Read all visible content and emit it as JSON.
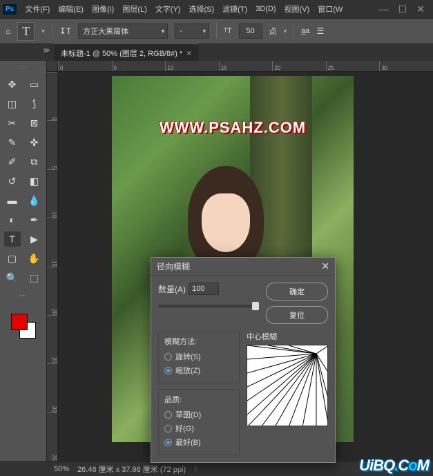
{
  "app": {
    "badge": "Ps"
  },
  "menu": {
    "file": "文件(F)",
    "edit": "编辑(E)",
    "image": "图像(I)",
    "layer": "图层(L)",
    "type": "文字(Y)",
    "select": "选择(S)",
    "filter": "滤镜(T)",
    "threeD": "3D(D)",
    "view": "视图(V)",
    "window": "窗口(W"
  },
  "options": {
    "font": "方正大黑简体",
    "style": "-",
    "size": "50",
    "size_unit": "点",
    "tool_glyph": "T"
  },
  "doc_tab": {
    "title": "未标题-1 @ 50% (图层 2, RGB/8#) *"
  },
  "ruler_h": [
    "0",
    "5",
    "10",
    "15",
    "20",
    "25",
    "30"
  ],
  "ruler_v": [
    "0",
    "5",
    "10",
    "15",
    "20",
    "25",
    "30",
    "35"
  ],
  "canvas": {
    "watermark": "WWW.PSAHZ.COM"
  },
  "tools": [
    "move",
    "artboard",
    "marquee",
    "lasso",
    "crop",
    "frame",
    "eyedropper",
    "patch",
    "brush",
    "clone",
    "history",
    "eraser",
    "gradient",
    "blur",
    "pen",
    "dodge",
    "type",
    "path",
    "rect",
    "hand",
    "zoom",
    "threeD"
  ],
  "status": {
    "zoom": "50%",
    "doc_info": "26.46 厘米 x 37.96 厘米 (72 ppi)"
  },
  "dialog": {
    "title": "径向模糊",
    "ok": "确定",
    "reset": "复位",
    "amount_label": "数量(A)",
    "amount_value": "100",
    "method_legend": "模糊方法:",
    "method_spin": "旋转(S)",
    "method_zoom": "缩放(Z)",
    "quality_legend": "品质:",
    "quality_draft": "草图(D)",
    "quality_good": "好(G)",
    "quality_best": "最好(B)",
    "center_label": "中心模糊"
  },
  "site_watermark": {
    "a": "U",
    "b": "i",
    "c": "B",
    "d": "Q",
    "dot1": ".",
    "dot2": ".",
    "e": "C",
    "f": "o",
    "g": "M"
  }
}
